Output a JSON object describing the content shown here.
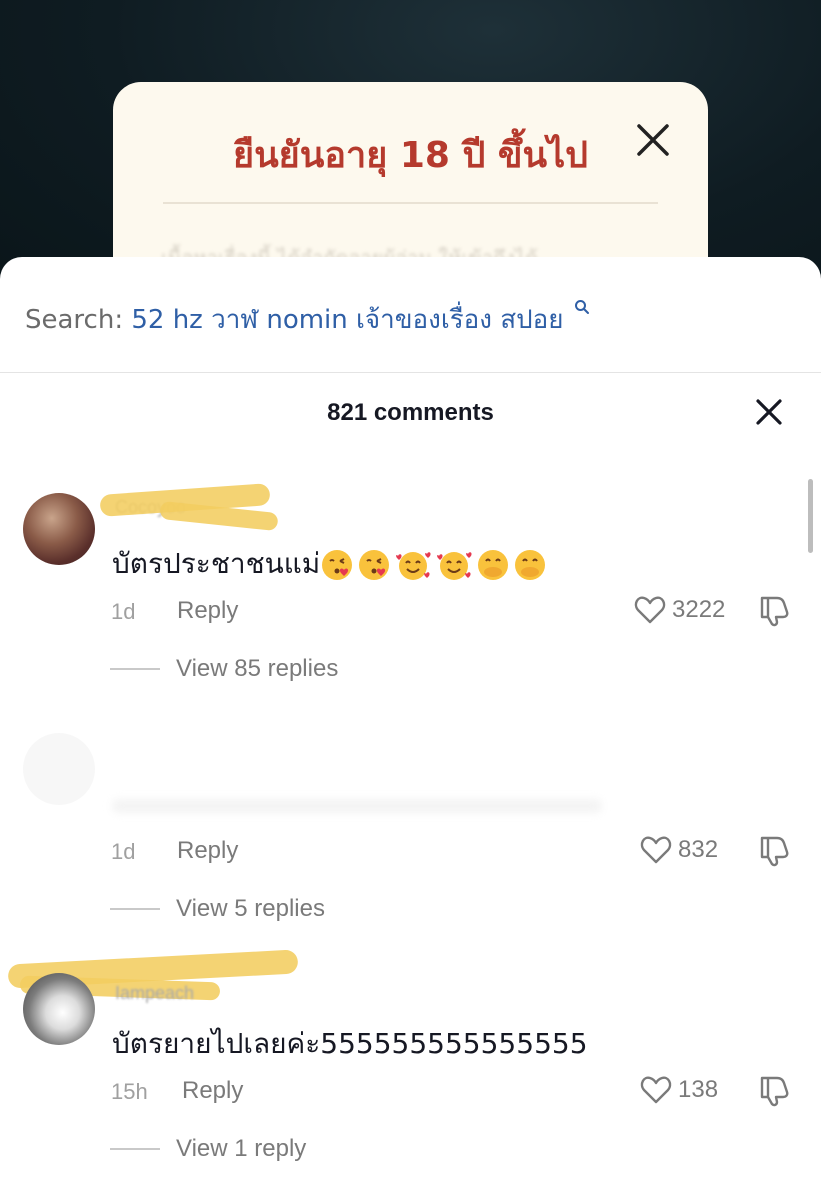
{
  "modal": {
    "title": "ยืนยันอายุ 18 ปี ขึ้นไป",
    "blurred_text": "เนื้อหาเรื่องนี้ ได้จำกัดอายุผู้อ่าน ให้เข้าถึงได้"
  },
  "search": {
    "label": "Search:",
    "query": "52 hz วาฬ nomin เจ้าของเรื่อง สปอย"
  },
  "comments_header": {
    "count_label": "821 comments"
  },
  "comments": [
    {
      "username": "Cocoyoo",
      "text": "บัตรประชาชนแม่",
      "emojis": [
        "kissing-heart",
        "kissing-heart",
        "smiling-hearts",
        "smiling-hearts",
        "hand-over-mouth",
        "hand-over-mouth"
      ],
      "time": "1d",
      "reply_label": "Reply",
      "likes": "3222",
      "view_replies": "View 85 replies"
    },
    {
      "username": "",
      "text": "",
      "time": "1d",
      "reply_label": "Reply",
      "likes": "832",
      "view_replies": "View 5 replies"
    },
    {
      "username": "Iampeach",
      "text": "บัตรยายไปเลยค่ะ555555555555555",
      "time": "15h",
      "reply_label": "Reply",
      "likes": "138",
      "view_replies": "View 1 reply"
    }
  ],
  "colors": {
    "modal_title": "#b53a2d",
    "search_query": "#2f5fa6",
    "scribble": "#f3cd60"
  }
}
